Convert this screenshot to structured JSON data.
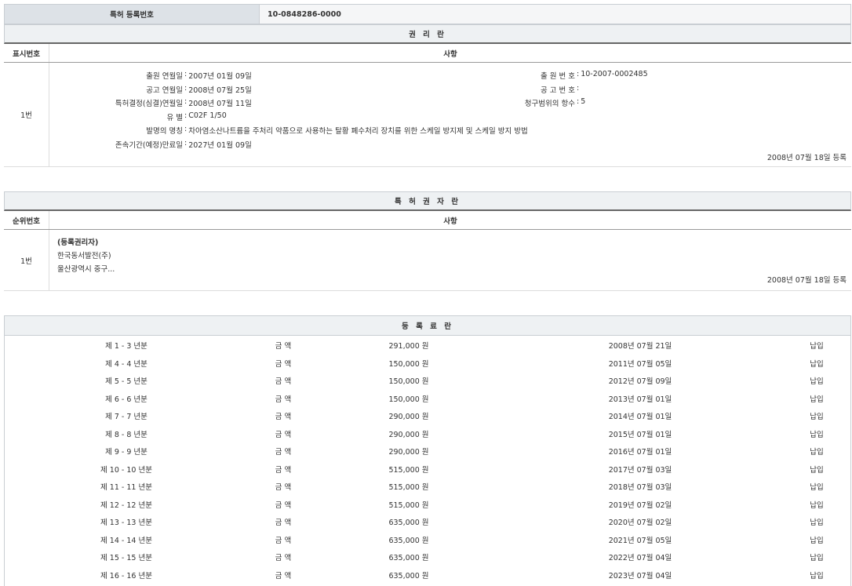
{
  "registration": {
    "label": "특허 등록번호",
    "number": "10-0848286-0000"
  },
  "rights": {
    "title": "권 리 란",
    "col_no": "표시번호",
    "col_content": "사항",
    "row_no": "1번",
    "filing_date_label": "출원 연월일",
    "filing_date": "2007년 01월 09일",
    "application_no_label": "출 원 번 호",
    "application_no": "10-2007-0002485",
    "pub_date_label": "공고 연월일",
    "pub_date": "2008년 07월 25일",
    "pub_no_label": "공 고 번 호",
    "pub_no": "",
    "decision_date_label": "특허결정(심결)연월일",
    "decision_date": "2008년 07월 11일",
    "claims_label": "청구범위의 항수",
    "claims": "5",
    "class_label": "유 별",
    "class": "C02F 1/50",
    "title_label": "발명의 명칭",
    "invention_title": "차아염소산나트륨을 주처리 약품으로 사용하는 탈황 폐수처리 장치를 위한 스케일 방지제 및 스케일 방지 방법",
    "expiry_label": "존속기간(예정)만료일",
    "expiry": "2027년 01월 09일",
    "reg_date": "2008년 07월 18일 등록"
  },
  "owner": {
    "title": "특 허 권 자 란",
    "col_no": "순위번호",
    "col_content": "사항",
    "row_no": "1번",
    "role": "(등록권리자)",
    "name": "한국동서발전(주)",
    "address": "울산광역시 중구...",
    "reg_date": "2008년 07월 18일 등록"
  },
  "fees": {
    "title": "등 록 료 란",
    "rows": [
      {
        "term": "제 1 - 3 년분",
        "label": "금 액",
        "amount": "291,000 원",
        "date": "2008년 07월 21일",
        "status": "납입"
      },
      {
        "term": "제 4 - 4 년분",
        "label": "금 액",
        "amount": "150,000 원",
        "date": "2011년 07월 05일",
        "status": "납입"
      },
      {
        "term": "제 5 - 5 년분",
        "label": "금 액",
        "amount": "150,000 원",
        "date": "2012년 07월 09일",
        "status": "납입"
      },
      {
        "term": "제 6 - 6 년분",
        "label": "금 액",
        "amount": "150,000 원",
        "date": "2013년 07월 01일",
        "status": "납입"
      },
      {
        "term": "제 7 - 7 년분",
        "label": "금 액",
        "amount": "290,000 원",
        "date": "2014년 07월 01일",
        "status": "납입"
      },
      {
        "term": "제 8 - 8 년분",
        "label": "금 액",
        "amount": "290,000 원",
        "date": "2015년 07월 01일",
        "status": "납입"
      },
      {
        "term": "제 9 - 9 년분",
        "label": "금 액",
        "amount": "290,000 원",
        "date": "2016년 07월 01일",
        "status": "납입"
      },
      {
        "term": "제 10 - 10 년분",
        "label": "금 액",
        "amount": "515,000 원",
        "date": "2017년 07월 03일",
        "status": "납입"
      },
      {
        "term": "제 11 - 11 년분",
        "label": "금 액",
        "amount": "515,000 원",
        "date": "2018년 07월 03일",
        "status": "납입"
      },
      {
        "term": "제 12 - 12 년분",
        "label": "금 액",
        "amount": "515,000 원",
        "date": "2019년 07월 02일",
        "status": "납입"
      },
      {
        "term": "제 13 - 13 년분",
        "label": "금 액",
        "amount": "635,000 원",
        "date": "2020년 07월 02일",
        "status": "납입"
      },
      {
        "term": "제 14 - 14 년분",
        "label": "금 액",
        "amount": "635,000 원",
        "date": "2021년 07월 05일",
        "status": "납입"
      },
      {
        "term": "제 15 - 15 년분",
        "label": "금 액",
        "amount": "635,000 원",
        "date": "2022년 07월 04일",
        "status": "납입"
      },
      {
        "term": "제 16 - 16 년분",
        "label": "금 액",
        "amount": "635,000 원",
        "date": "2023년 07월 04일",
        "status": "납입"
      }
    ]
  }
}
